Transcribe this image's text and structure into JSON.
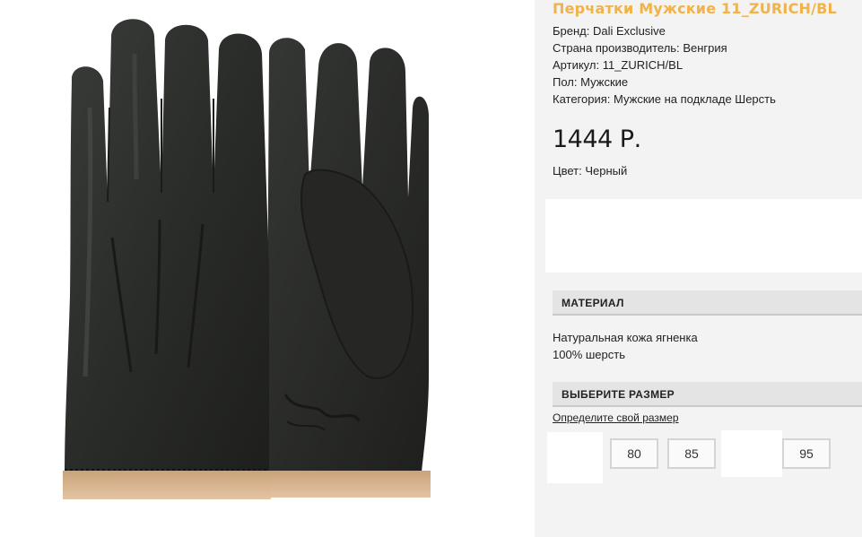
{
  "product": {
    "title": "Перчатки Мужские 11_ZURICH/BL",
    "specs": [
      {
        "key": "Бренд:",
        "value": "Dali Exclusive"
      },
      {
        "key": "Страна производитель:",
        "value": "Венгрия"
      },
      {
        "key": "Артикул:",
        "value": "11_ZURICH/BL"
      },
      {
        "key": "Пол:",
        "value": "Мужские"
      },
      {
        "key": "Категория:",
        "value": "Мужские на подкладе Шерсть"
      }
    ],
    "price": "1444 Р.",
    "color_label": "Цвет:",
    "color_value": "Черный"
  },
  "material": {
    "heading": "МАТЕРИАЛ",
    "lines": [
      "Натуральная кожа ягненка",
      "100% шерсть"
    ]
  },
  "size": {
    "heading": "ВЫБЕРИТЕ РАЗМЕР",
    "link": "Определите свой размер",
    "options": [
      "80",
      "85",
      "95"
    ]
  },
  "colors": {
    "title": "#f0b24a",
    "glove": "#2b2d2a",
    "cuff": "#d9b48f",
    "panel": "#f3f3f3"
  }
}
